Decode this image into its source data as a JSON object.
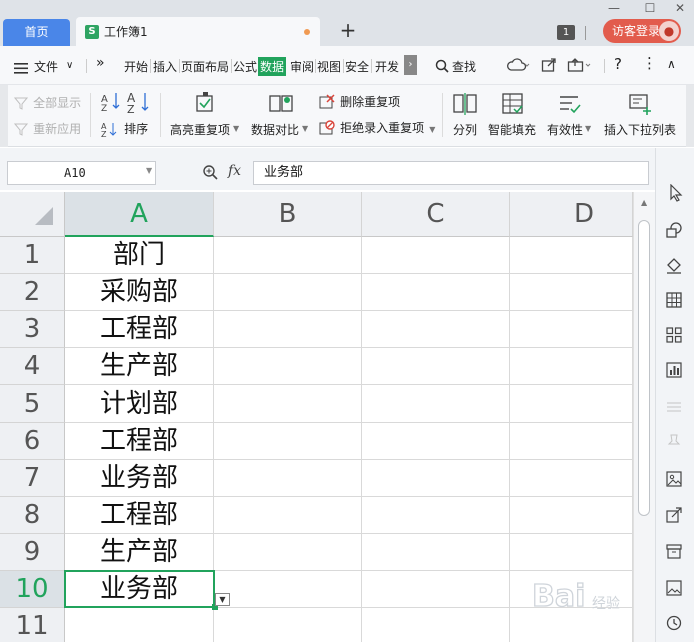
{
  "titlebar": {
    "home_tab": "首页",
    "doc_logo": "S",
    "doc_title": "工作簿1",
    "new_tab": "+",
    "win_min": "—",
    "win_max": "☐",
    "win_close": "✕",
    "badge_count": "1",
    "login_label": "访客登录"
  },
  "menubar": {
    "file_label": "文件",
    "more_label": "»",
    "items": [
      "开始",
      "插入",
      "页面布局",
      "公式",
      "数据",
      "审阅",
      "视图",
      "安全",
      "开发"
    ],
    "active_item": "数据",
    "search_label": "查找"
  },
  "ribbon": {
    "show_all": "全部显示",
    "reapply": "重新应用",
    "sort": "排序",
    "highlight_dup": "高亮重复项",
    "data_compare": "数据对比",
    "remove_dup": "删除重复项",
    "reject_dup": "拒绝录入重复项",
    "split": "分列",
    "smart_fill": "智能填充",
    "validity": "有效性",
    "insert_dropdown": "插入下拉列表"
  },
  "formula_bar": {
    "cell_ref": "A10",
    "fx_label": "fx",
    "formula_value": "业务部"
  },
  "sheet": {
    "columns": [
      "A",
      "B",
      "C",
      "D"
    ],
    "selected_column": "A",
    "rows": [
      "1",
      "2",
      "3",
      "4",
      "5",
      "6",
      "7",
      "8",
      "9",
      "10",
      "11"
    ],
    "selected_row": "10",
    "column_a_values": [
      "部门",
      "采购部",
      "工程部",
      "生产部",
      "计划部",
      "工程部",
      "业务部",
      "工程部",
      "生产部",
      "业务部",
      ""
    ]
  },
  "colors": {
    "accent_green": "#21a35c",
    "home_tab_blue": "#4a86e8",
    "login_red": "#e25c4d"
  },
  "watermark": "Baidu 经验"
}
